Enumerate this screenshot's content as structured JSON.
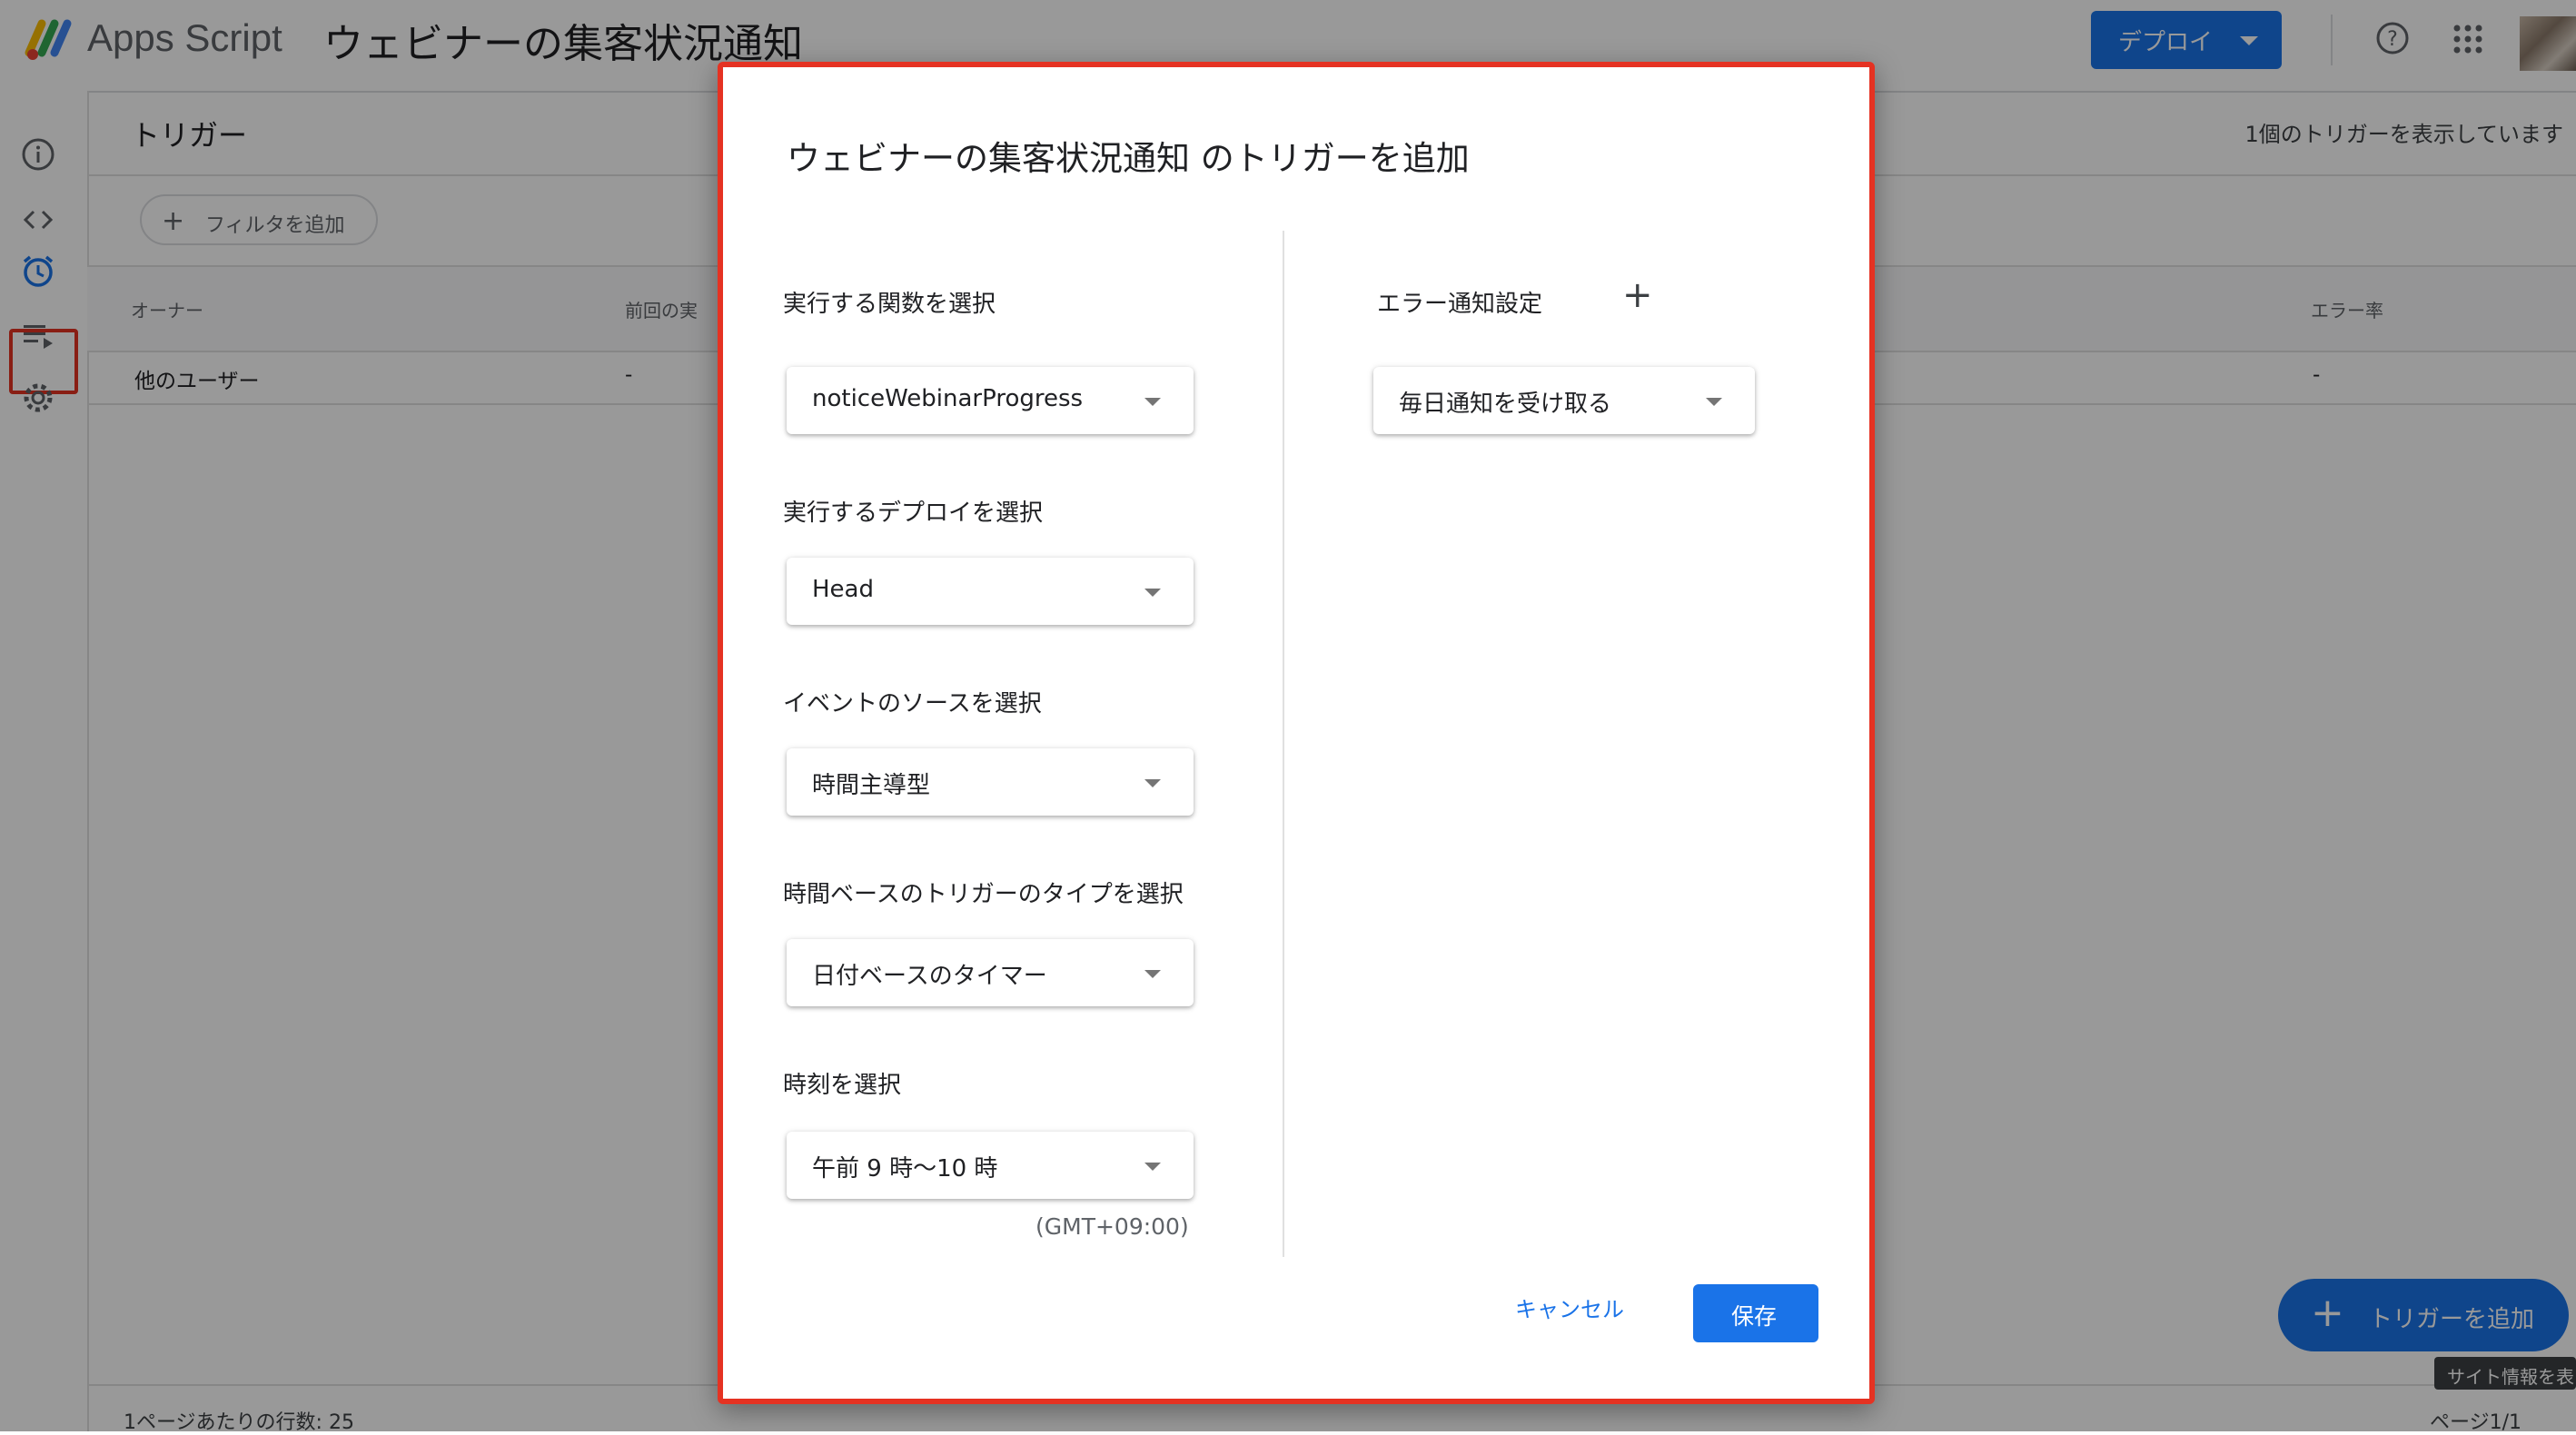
{
  "header": {
    "app_name": "Apps Script",
    "project_title": "ウェビナーの集客状況通知",
    "deploy_label": "デプロイ"
  },
  "page": {
    "title": "トリガー",
    "trigger_count_label": "1個のトリガーを表示しています",
    "filter_label": "フィルタを追加",
    "table": {
      "columns": [
        "オーナー",
        "前回の実",
        "エラー率"
      ],
      "rows": [
        {
          "owner": "他のユーザー",
          "last_run": "-",
          "error_rate": "-"
        }
      ]
    },
    "fab_label": "トリガーを追加",
    "tooltip": "サイト情報を表",
    "footer_rows_label": "1ページあたりの行数: 25",
    "footer_pager": "ページ1/1"
  },
  "dialog": {
    "title": "ウェビナーの集客状況通知 のトリガーを追加",
    "fields": [
      {
        "label": "実行する関数を選択",
        "value": "noticeWebinarProgress"
      },
      {
        "label": "実行するデプロイを選択",
        "value": "Head"
      },
      {
        "label": "イベントのソースを選択",
        "value": "時間主導型"
      },
      {
        "label": "時間ベースのトリガーのタイプを選択",
        "value": "日付ベースのタイマー"
      },
      {
        "label": "時刻を選択",
        "value": "午前 9 時～10 時"
      }
    ],
    "timezone": "(GMT+09:00)",
    "error_settings_label": "エラー通知設定",
    "error_select_value": "毎日通知を受け取る",
    "cancel_label": "キャンセル",
    "save_label": "保存"
  },
  "colors": {
    "accent": "#1a73e8",
    "highlight_border": "#e53222"
  }
}
